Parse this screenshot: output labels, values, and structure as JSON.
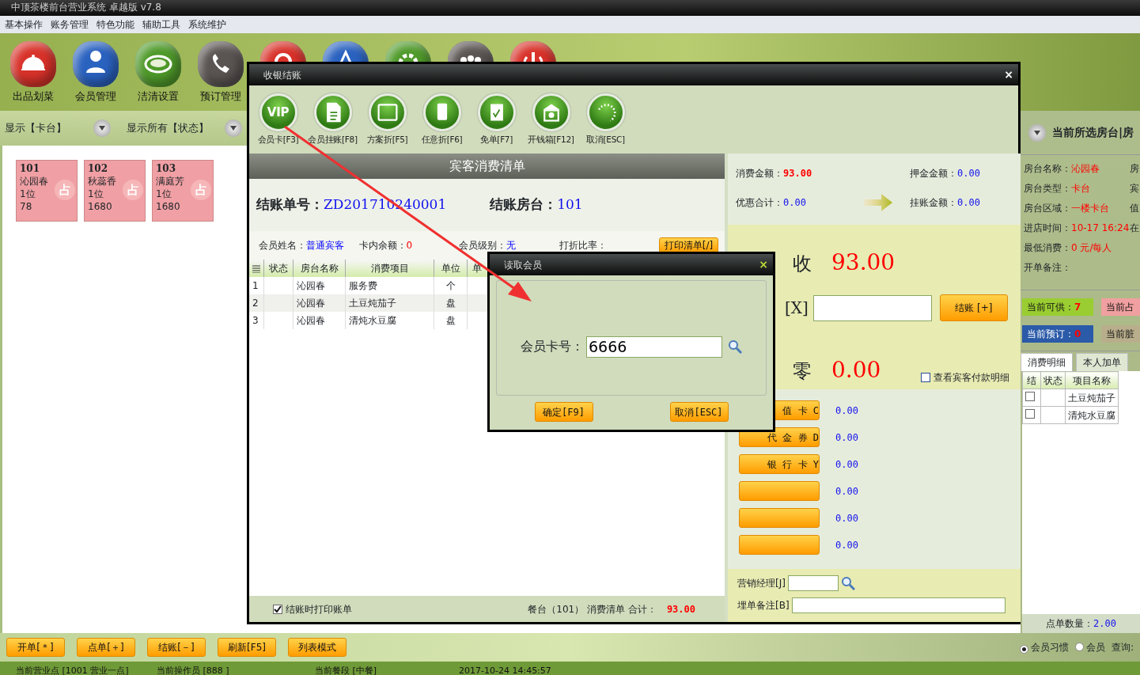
{
  "window": {
    "title": "中顶茶楼前台营业系统 卓越版 v7.8"
  },
  "menu": [
    "基本操作",
    "账务管理",
    "特色功能",
    "辅助工具",
    "系统维护"
  ],
  "toolbar": [
    {
      "label": "出品划菜",
      "color": "#d8322a"
    },
    {
      "label": "会员管理",
      "color": "#2a62c0"
    },
    {
      "label": "洁清设置",
      "color": "#4f9a2a"
    },
    {
      "label": "预订管理",
      "color": "#5a5452"
    },
    {
      "color": "#d8322a"
    },
    {
      "color": "#2a62c0"
    },
    {
      "color": "#4f9a2a"
    },
    {
      "color": "#5a5452"
    },
    {
      "color": "#d8322a"
    }
  ],
  "filters": [
    "显示【卡台】",
    "显示所有【状态】"
  ],
  "rooms": [
    {
      "number": "101",
      "name": "沁园春",
      "guests": "1位",
      "amount": "78",
      "tag": "占"
    },
    {
      "number": "102",
      "name": "秋蕊香",
      "guests": "1位",
      "amount": "1680",
      "tag": "占"
    },
    {
      "number": "103",
      "name": "满庭芳",
      "guests": "1位",
      "amount": "1680",
      "tag": "占"
    }
  ],
  "side_panel": {
    "header": "当前所选房台|房",
    "info": [
      {
        "label": "房台名称：",
        "value": "沁园春",
        "next": "房"
      },
      {
        "label": "房台类型：",
        "value": "卡台",
        "next": "宾"
      },
      {
        "label": "房台区域：",
        "value": "一楼卡台",
        "next": "值"
      },
      {
        "label": "进店时间：",
        "value": "10-17 16:24",
        "next": "在"
      },
      {
        "label": "最低消费：",
        "value": "0 元/每人"
      },
      {
        "label": "开单备注："
      }
    ],
    "tiles": [
      {
        "label": "当前可供：",
        "value": "7",
        "color": "#9acd32"
      },
      {
        "label": "当前占",
        "color": "#f0a0a0"
      },
      {
        "label": "当前预订：",
        "value": "0",
        "color": "#2b5aa8"
      },
      {
        "label": "当前脏",
        "color": "#b8ae8c"
      }
    ],
    "tabs": [
      {
        "label": "消费明细",
        "selected": true
      },
      {
        "label": "本人加单",
        "selected": false
      }
    ],
    "columns": [
      "结",
      "状态",
      "项目名称"
    ],
    "rows": [
      {
        "checked": false,
        "item": "土豆炖茄子"
      },
      {
        "checked": false,
        "item": "清炖水豆腐"
      }
    ],
    "count_label": "点单数量：",
    "count": "2.00"
  },
  "bottom_buttons": [
    "开单[＊]",
    "点单[＋]",
    "结账[－]",
    "刷新[F5]",
    "列表模式"
  ],
  "radios": [
    {
      "label": "会员习惯",
      "selected": true
    },
    {
      "label": "会员",
      "selected": false
    }
  ],
  "query_label": "查询:",
  "status_bar": [
    "当前营业点 [1001 营业一点]",
    "当前操作员 [888 ]",
    "当前餐段 [中餐]",
    "2017-10-24 14:45:57"
  ],
  "checkout_dialog": {
    "title": "收银结账",
    "close_label": "×",
    "vip_icon_text": "VIP",
    "tools": [
      "会员卡[F3]",
      "会员挂账[F8]",
      "方案折[F5]",
      "任意折[F6]",
      "免单[F7]",
      "开钱箱[F12]",
      "取消[ESC]"
    ],
    "list_title": "宾客消费清单",
    "bill_no_label": "结账单号：",
    "bill_no": "ZD201710240001",
    "room_label": "结账房台：",
    "room": "101",
    "member": [
      {
        "kind": "link",
        "label": "会员姓名：",
        "value": "普通宾客"
      },
      {
        "kind": "alert",
        "label": "卡内余额：",
        "value": "0"
      },
      {
        "kind": "link",
        "label": "会员级别：",
        "value": "无"
      },
      {
        "label": "打折比率："
      }
    ],
    "print_button": "打印清单[/]",
    "columns": [
      "状态",
      "房台名称",
      "消费项目",
      "单位",
      "单"
    ],
    "rows": [
      {
        "no": "1",
        "room": "沁园春",
        "item": "服务费",
        "unit": "个"
      },
      {
        "no": "2",
        "room": "沁园春",
        "item": "土豆炖茄子",
        "unit": "盘"
      },
      {
        "no": "3",
        "room": "沁园春",
        "item": "清炖水豆腐",
        "unit": "盘"
      }
    ],
    "print_on_checkout": {
      "label": "结账时打印账单",
      "checked": true
    },
    "footer": {
      "text": "餐台（101） 消费清单 合计：",
      "total": "93.00"
    },
    "summary": [
      {
        "label": "消费金额：",
        "value": "93.00",
        "color": "#ff0000"
      },
      {
        "label": "押金金额：",
        "value": "0.00",
        "color": "#1010ee"
      },
      {
        "label": "优惠合计：",
        "value": "0.00",
        "color": "#1010ee"
      },
      {
        "label": "挂账金额：",
        "value": "0.00",
        "color": "#1010ee"
      }
    ],
    "due_label": "收",
    "due": "93.00",
    "paid_label": "[X]",
    "settle_button": "结账 [+]",
    "change_label": "零",
    "change": "0.00",
    "show_detail": {
      "label": "查看宾客付款明细",
      "checked": false
    },
    "payments": [
      {
        "label": "值 卡 C",
        "amount": "0.00"
      },
      {
        "label": "代 金 券 D",
        "amount": "0.00"
      },
      {
        "label": "银 行 卡 Y",
        "amount": "0.00"
      },
      {
        "amount": "0.00"
      },
      {
        "amount": "0.00"
      },
      {
        "amount": "0.00"
      }
    ],
    "manager_label": "营销经理[J]",
    "remark_label": "埋单备注[B]"
  },
  "member_dialog": {
    "title": "读取会员",
    "close_label": "×",
    "card_label": "会员卡号：",
    "card_value": "6666",
    "buttons": [
      "确定[F9]",
      "取消[ESC]"
    ]
  }
}
